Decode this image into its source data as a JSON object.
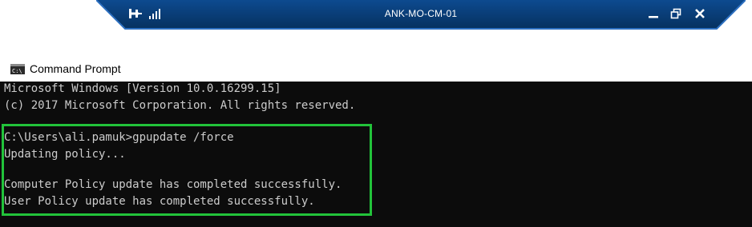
{
  "rdp_bar": {
    "title": "ANK-MO-CM-01",
    "bar_color": "#0a3f7e",
    "icons": [
      "pin-icon",
      "signal-bars-icon",
      "minimize-icon",
      "restore-icon",
      "close-icon"
    ]
  },
  "window": {
    "title": "Command Prompt",
    "icon": "command-prompt-icon"
  },
  "console": {
    "background": "#0c0c0c",
    "text_color": "#cccccc",
    "highlight_color": "#22c33a",
    "lines": [
      "Microsoft Windows [Version 10.0.16299.15]",
      "(c) 2017 Microsoft Corporation. All rights reserved.",
      "",
      "C:\\Users\\ali.pamuk>gpupdate /force",
      "Updating policy...",
      "",
      "Computer Policy update has completed successfully.",
      "User Policy update has completed successfully."
    ]
  }
}
